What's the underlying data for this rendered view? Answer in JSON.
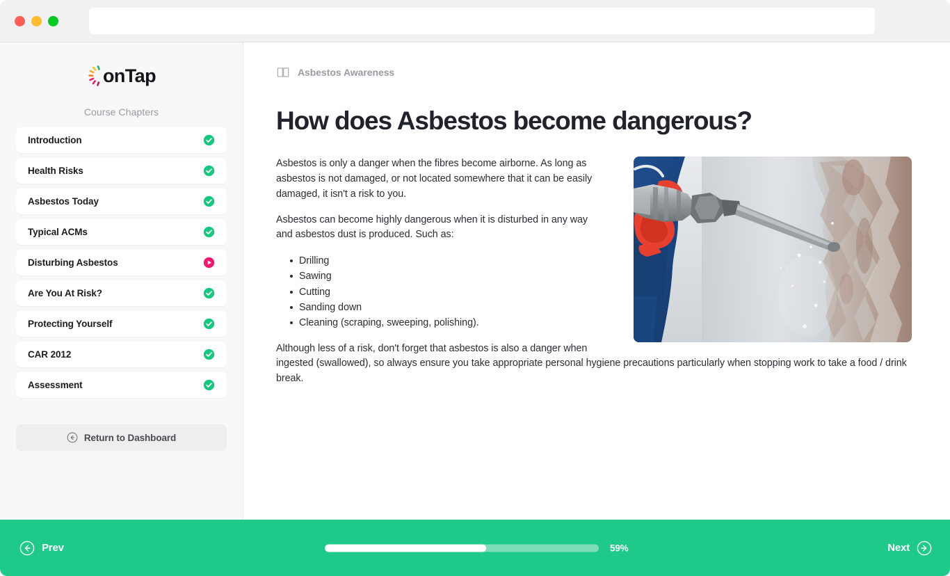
{
  "browser": {
    "url_value": "",
    "url_placeholder": "",
    "traffic_lights": [
      "close-red",
      "minimize-yellow",
      "maximize-green"
    ]
  },
  "sidebar": {
    "logo_text": "onTap",
    "logo_icon": "sunburst-icon",
    "section_label": "Course Chapters",
    "chapters": [
      {
        "label": "Introduction",
        "status": "complete"
      },
      {
        "label": "Health Risks",
        "status": "complete"
      },
      {
        "label": "Asbestos Today",
        "status": "complete"
      },
      {
        "label": "Typical ACMs",
        "status": "complete"
      },
      {
        "label": "Disturbing Asbestos",
        "status": "current"
      },
      {
        "label": "Are You At Risk?",
        "status": "complete"
      },
      {
        "label": "Protecting Yourself",
        "status": "complete"
      },
      {
        "label": "CAR 2012",
        "status": "complete"
      },
      {
        "label": "Assessment",
        "status": "complete"
      }
    ],
    "return_button": {
      "label": "Return to Dashboard",
      "icon": "arrow-left-circle-icon"
    }
  },
  "main": {
    "breadcrumb": {
      "icon": "book-open-icon",
      "text": "Asbestos Awareness"
    },
    "title": "How does Asbestos become dangerous?",
    "paragraph_1": "Asbestos is only a danger when the fibres become airborne. As long as asbestos is not damaged, or not located somewhere that it can be easily damaged, it isn't a risk to you.",
    "paragraph_2": "Asbestos can become highly dangerous when it is disturbed in any way and asbestos dust is produced. Such as:",
    "bullets": [
      "Drilling",
      "Sawing",
      "Cutting",
      "Sanding down",
      "Cleaning (scraping, sweeping, polishing)."
    ],
    "paragraph_3": "Although less of a risk, don't forget that asbestos is also a danger when ingested (swallowed), so always ensure you take appropriate personal hygiene precautions particularly when stopping work to take a food / drink break.",
    "image_alt": "Worker in blue overalls with red gloves using a demolition drill on a concrete wall"
  },
  "footer": {
    "prev": {
      "label": "Prev",
      "icon": "arrow-left-circle-icon"
    },
    "next": {
      "label": "Next",
      "icon": "arrow-right-circle-icon"
    },
    "progress_percent": 59,
    "progress_label": "59%"
  },
  "colors": {
    "accent_green": "#1ec98a",
    "status_complete": "#12c97e",
    "status_current": "#f5176e",
    "title_dark": "#20222c",
    "muted_gray": "#9b9ba3",
    "sidebar_bg": "#f8f8f9"
  }
}
